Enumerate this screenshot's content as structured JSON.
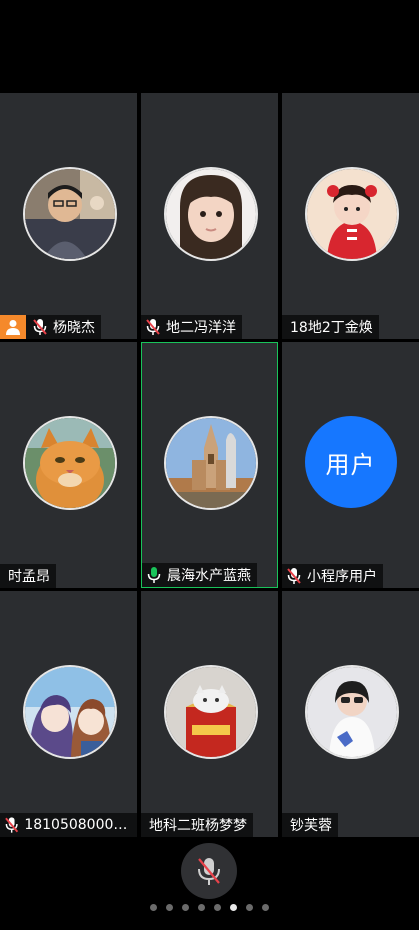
{
  "participants": [
    {
      "name": "杨晓杰",
      "host": true,
      "mic": "muted",
      "avatar": "photo-man"
    },
    {
      "name": "地二冯洋洋",
      "host": false,
      "mic": "muted",
      "avatar": "photo-girl"
    },
    {
      "name": "18地2丁金焕",
      "host": false,
      "mic": "none",
      "avatar": "photo-child-red"
    },
    {
      "name": "时孟昂",
      "host": false,
      "mic": "none",
      "avatar": "photo-cat"
    },
    {
      "name": "晨海水产蓝燕",
      "host": false,
      "mic": "active",
      "avatar": "photo-church",
      "active": true
    },
    {
      "name": "小程序用户",
      "host": false,
      "mic": "muted",
      "avatar_text": "用户"
    },
    {
      "name": "18105080003...",
      "host": false,
      "mic": "muted",
      "avatar": "anime"
    },
    {
      "name": "地科二班杨梦梦",
      "host": false,
      "mic": "none",
      "avatar": "photo-cat-box"
    },
    {
      "name": "钞芙蓉",
      "host": false,
      "mic": "none",
      "avatar": "photo-girl-white"
    }
  ],
  "colors": {
    "tile_bg": "#2b2d30",
    "active_border": "#19c35a",
    "muted_red": "#e8424a",
    "speaking_green": "#19c35a",
    "host_orange": "#f5892b",
    "avatar_blue": "#1677ff"
  },
  "bottom_mic": {
    "icon": "mic-muted-icon"
  },
  "pager": {
    "count": 8,
    "current": 6
  }
}
